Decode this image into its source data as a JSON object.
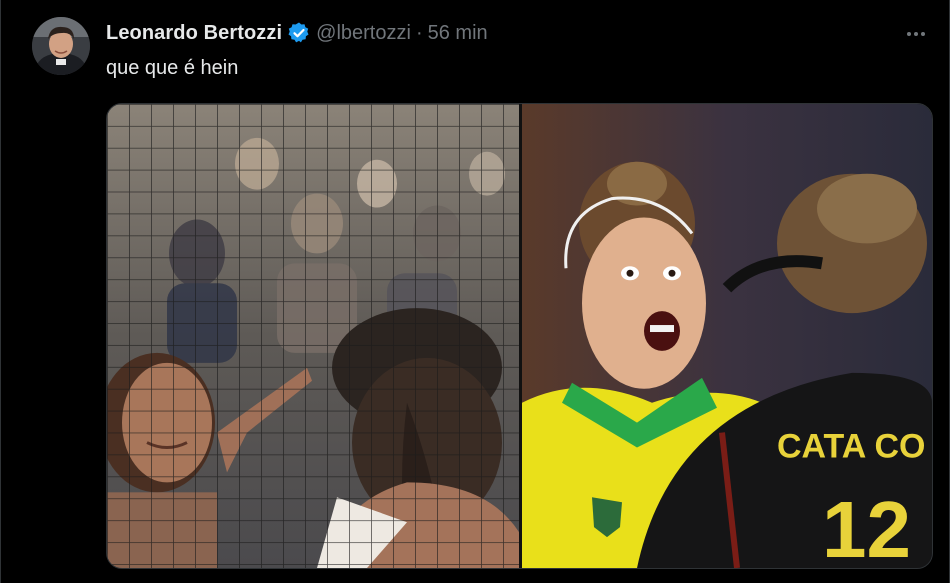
{
  "tweet": {
    "author_name": "Leonardo Bertozzi",
    "handle": "@lbertozzi",
    "separator": "·",
    "time": "56 min",
    "text": "que que é hein",
    "icons": {
      "avatar": "avatar",
      "verified": "verified-badge-icon",
      "more": "more-options-icon"
    },
    "colors": {
      "background": "#000000",
      "primary_text": "#e7e9ea",
      "secondary_text": "#71767b",
      "verified": "#1d9bf0",
      "border": "#2f3336"
    },
    "media": [
      {
        "kind": "photo",
        "description_icon": "photo-left"
      },
      {
        "kind": "photo",
        "description_icon": "photo-right",
        "jersey_text": "CATA CO"
      }
    ]
  }
}
